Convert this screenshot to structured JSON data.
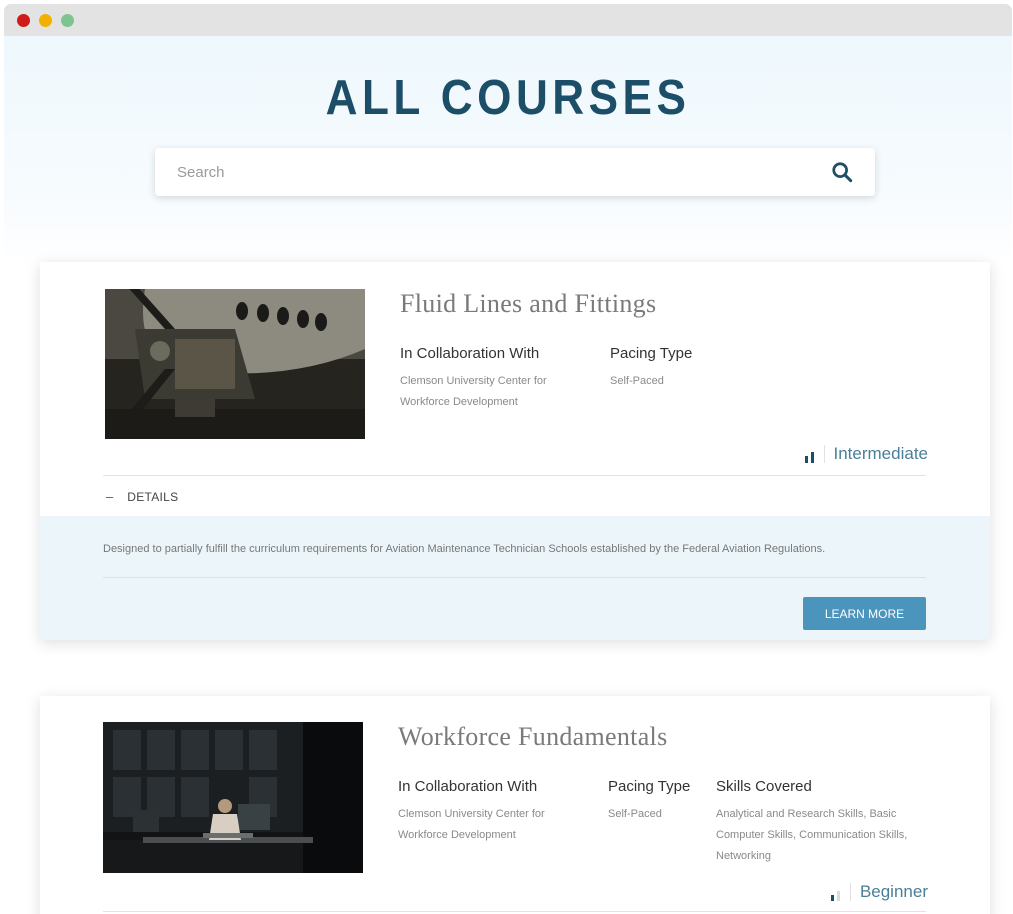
{
  "page": {
    "title": "ALL COURSES"
  },
  "search": {
    "placeholder": "Search",
    "value": ""
  },
  "courses": [
    {
      "title": "Fluid Lines and Fittings",
      "collab_label": "In Collaboration With",
      "collab_value": "Clemson University Center for Workforce Development",
      "pacing_label": "Pacing Type",
      "pacing_value": "Self-Paced",
      "level": "Intermediate",
      "level_bars": 2,
      "details_label": "DETAILS",
      "description": "Designed to partially fulfill the curriculum requirements for Aviation Maintenance Technician Schools established by the Federal Aviation Regulations.",
      "button_label": "LEARN MORE"
    },
    {
      "title": "Workforce Fundamentals",
      "collab_label": "In Collaboration With",
      "collab_value": "Clemson University Center for Workforce Development",
      "pacing_label": "Pacing Type",
      "pacing_value": "Self-Paced",
      "skills_label": "Skills Covered",
      "skills_value": "Analytical and Research Skills, Basic Computer Skills, Communication Skills, Networking",
      "level": "Beginner",
      "level_bars": 1
    }
  ],
  "colors": {
    "accent": "#1c4f67",
    "button": "#4b94bb",
    "details_bg": "#ecf6fa"
  }
}
